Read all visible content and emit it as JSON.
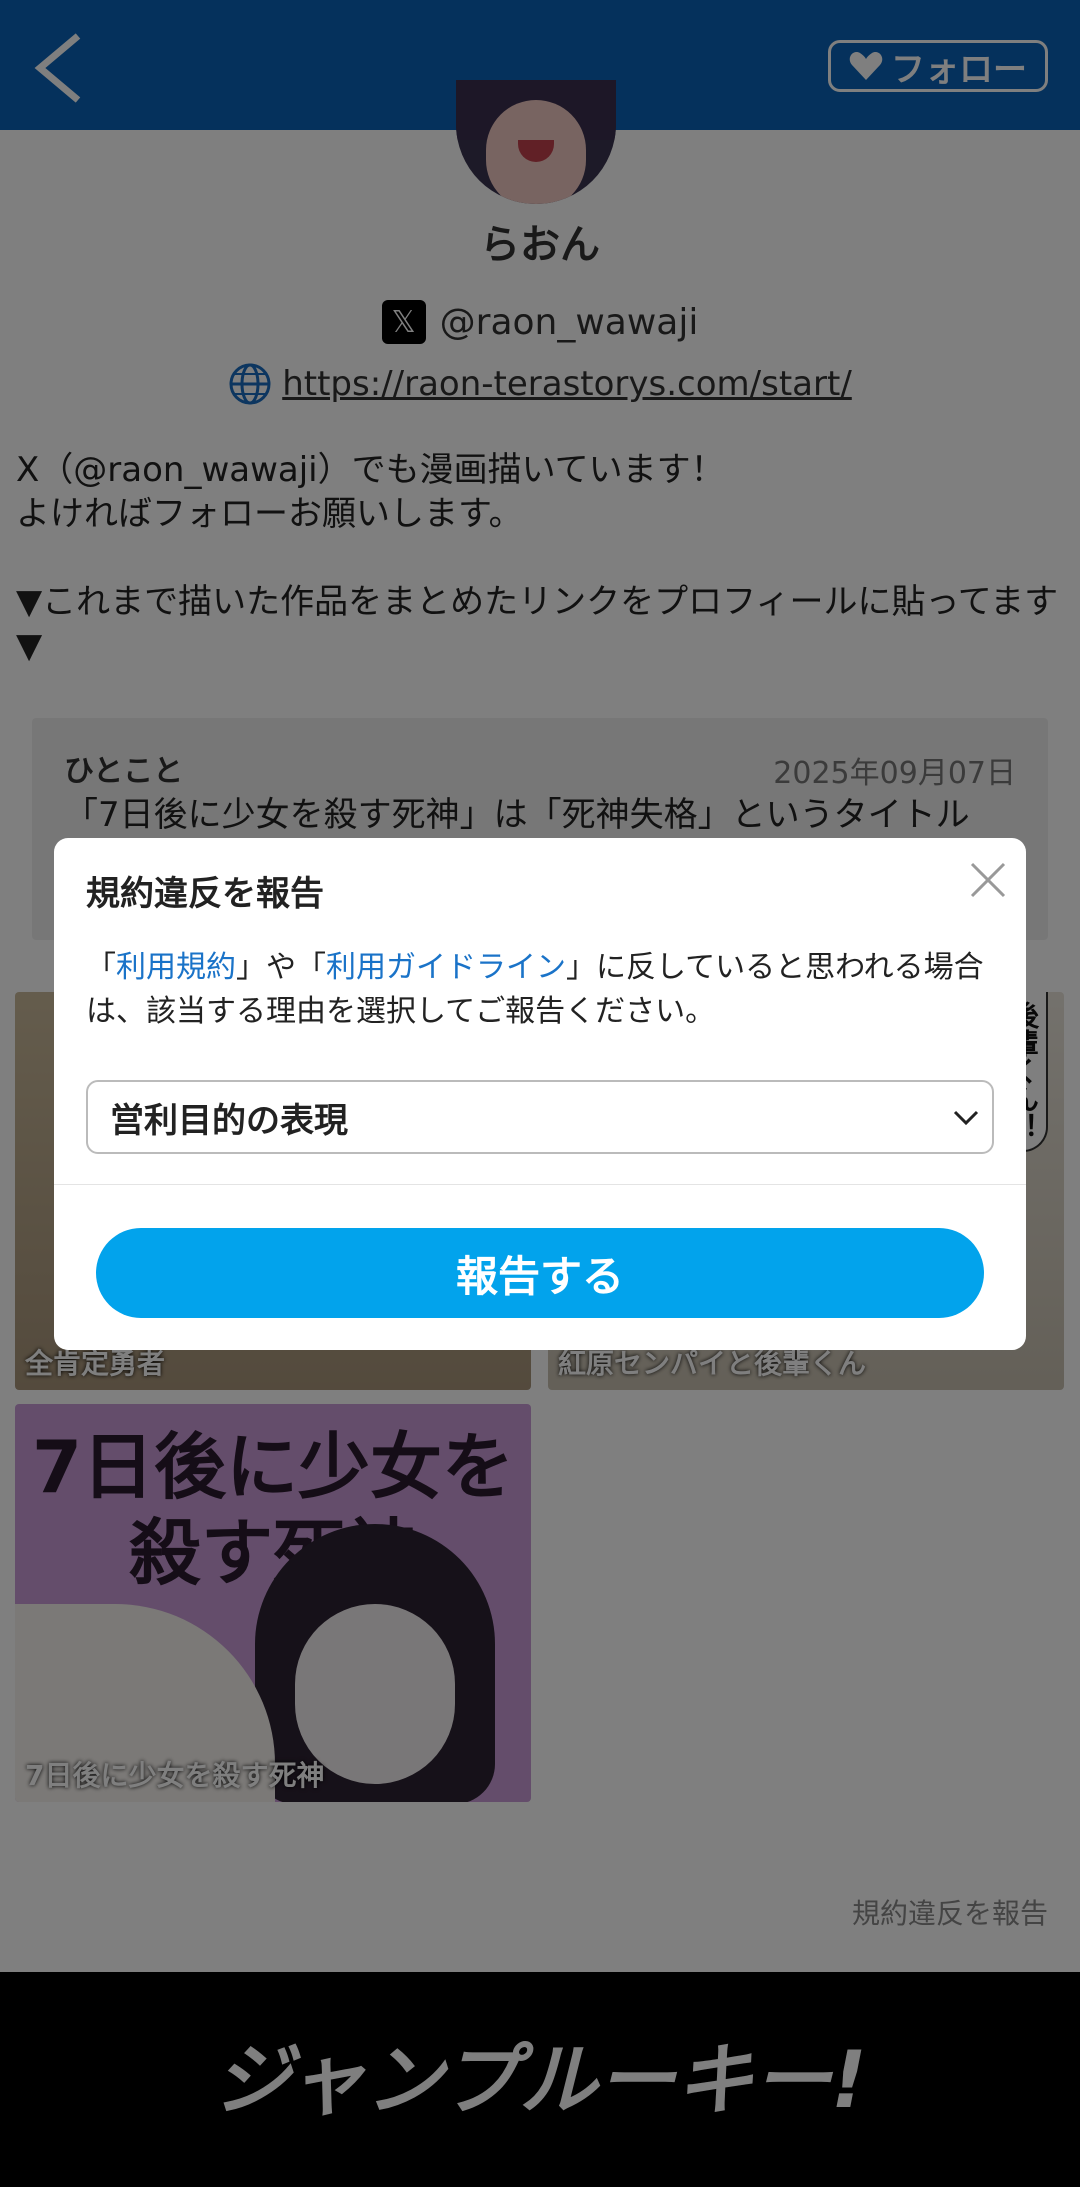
{
  "header": {
    "follow_label": "フォロー"
  },
  "profile": {
    "name": "らおん",
    "x_handle": "@raon_wawaji",
    "url": "https://raon-terastorys.com/start/",
    "bio": "X（@raon_wawaji）でも漫画描いています！\nよければフォローお願いします。\n\n▼これまで描いた作品をまとめたリンクをプロフィールに貼ってます▼"
  },
  "hitokoto": {
    "label": "ひとこと",
    "date": "2025年09月07日",
    "text": "「7日後に少女を殺す死神」は「死神失格」というタイトルで、ジャンプ＋インディーズでフルカラー版を連載中です。"
  },
  "works": [
    {
      "title": "全肯定勇者"
    },
    {
      "title": "紅原センパイと後輩くん",
      "tag": "後輩くん！"
    },
    {
      "title": "7日後に少女を殺す死神",
      "cover_text": "7日後に少女を\n殺す死神"
    }
  ],
  "report_link": "規約違反を報告",
  "footer": {
    "logo_text": "ジャンプルーキー!"
  },
  "modal": {
    "title": "規約違反を報告",
    "desc_prefix": "「",
    "terms_link": "利用規約",
    "desc_mid": "」や「",
    "guideline_link": "利用ガイドライン",
    "desc_suffix": "」に反していると思われる場合は、該当する理由を選択してご報告ください。",
    "selected_reason": "営利目的の表現",
    "submit_label": "報告する"
  },
  "colors": {
    "header": "#0a63b8",
    "submit": "#02a3ec",
    "link": "#1a73c8"
  }
}
